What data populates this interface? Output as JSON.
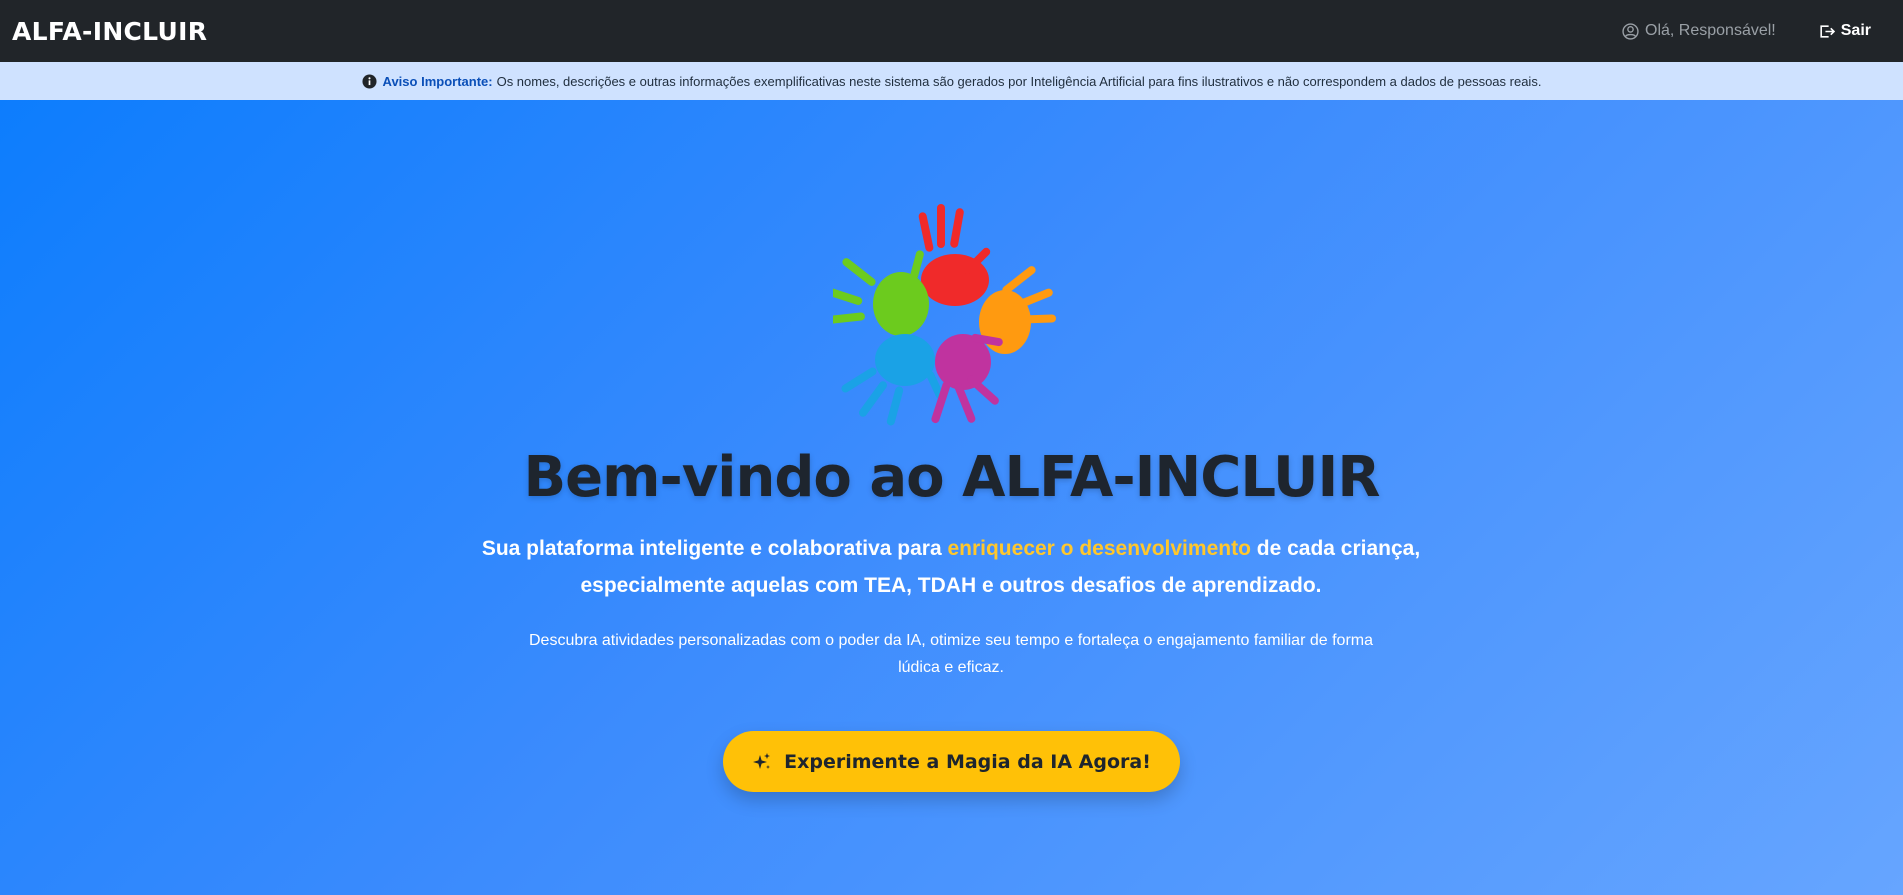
{
  "navbar": {
    "brand": "ALFA-INCLUIR",
    "user_greeting": "Olá, Responsável!",
    "user_icon": "user-circle-icon",
    "logout_label": "Sair",
    "logout_icon": "logout-icon",
    "background": "#212529"
  },
  "notice": {
    "icon": "info-circle-icon",
    "title": "Aviso Importante:",
    "text": "Os nomes, descrições e outras informações exemplificativas neste sistema são gerados por Inteligência Artificial para fins ilustrativos e não correspondem a dados de pessoas reais.",
    "background": "#cfe2ff"
  },
  "hero": {
    "logo": "colorful-hands-logo",
    "title": "Bem-vindo ao ALFA-INCLUIR",
    "lead_before": "Sua plataforma inteligente e colaborativa para ",
    "lead_highlight": "enriquecer o desenvolvimento",
    "lead_after": " de cada criança, especialmente aquelas com TEA, TDAH e outros desafios de aprendizado.",
    "subtitle": "Descubra atividades personalizadas com o poder da IA, otimize seu tempo e fortaleça o engajamento familiar de forma lúdica e eficaz.",
    "cta_label": "Experimente a Magia da IA Agora!",
    "cta_icon": "sparkles-icon",
    "accent": "#ffc107"
  }
}
